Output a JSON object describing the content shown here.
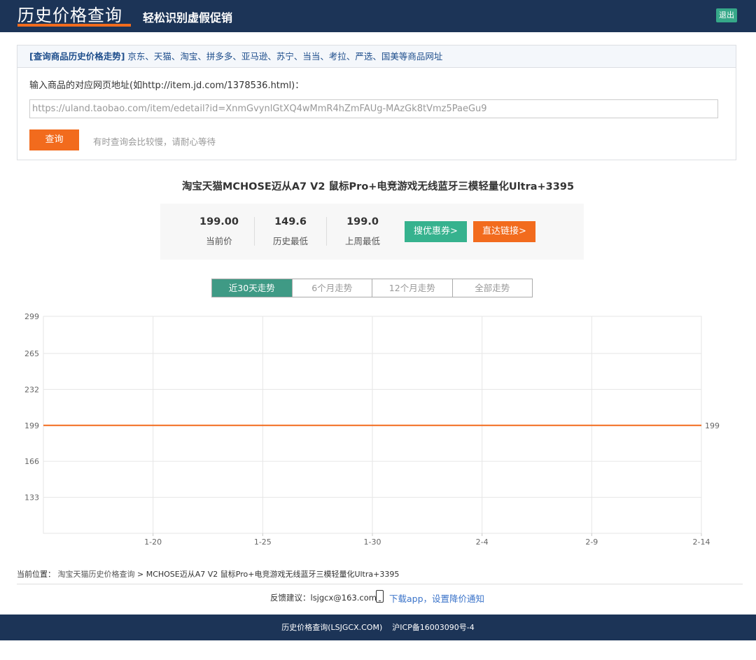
{
  "header": {
    "logo": "历史价格查询",
    "slogan": "轻松识别虚假促销",
    "logout": "退出"
  },
  "query": {
    "head_bold": "[查询商品历史价格走势]",
    "head_sites": "京东、天猫、淘宝、拼多多、亚马逊、苏宁、当当、考拉、严选、国美等商品网址",
    "label": "输入商品的对应网页地址(如http://item.jd.com/1378536.html)：",
    "url_value": "https://uland.taobao.com/item/edetail?id=XnmGvynlGtXQ4wMmR4hZmFAUg-MAzGk8tVmz5PaeGu9",
    "button": "查询",
    "tip": "有时查询会比较慢，请耐心等待"
  },
  "product": {
    "title": "淘宝天猫MCHOSE迈从A7 V2 鼠标Pro+电竞游戏无线蓝牙三模轻量化Ultra+3395",
    "stats": [
      {
        "value": "199.00",
        "label": "当前价"
      },
      {
        "value": "149.6",
        "label": "历史最低"
      },
      {
        "value": "199.0",
        "label": "上周最低"
      }
    ],
    "coupon_button": "搜优惠券>",
    "link_button": "直达链接>"
  },
  "tabs": [
    {
      "label": "近30天走势",
      "active": true
    },
    {
      "label": "6个月走势",
      "active": false
    },
    {
      "label": "12个月走势",
      "active": false
    },
    {
      "label": "全部走势",
      "active": false
    }
  ],
  "chart_data": {
    "type": "line",
    "x": [
      "1-20",
      "1-25",
      "1-30",
      "2-4",
      "2-9",
      "2-14"
    ],
    "y_ticks": [
      299,
      265,
      232,
      199,
      166,
      133
    ],
    "ylim": [
      100,
      299
    ],
    "series": [
      {
        "values": [
          199,
          199,
          199,
          199,
          199,
          199
        ],
        "end_label": "199",
        "color": "#f26b1d"
      }
    ],
    "grid": true
  },
  "footer": {
    "breadcrumb_prefix": "当前位置：",
    "breadcrumb_link": "淘宝天猫历史价格查询",
    "breadcrumb_rest": " > MCHOSE迈从A7 V2 鼠标Pro+电竞游戏无线蓝牙三模轻量化Ultra+3395",
    "feedback": "反馈建议：lsjgcx@163.com",
    "app_link": "下载app，设置降价通知",
    "site": "历史价格查询(LSJGCX.COM)",
    "icp": "沪ICP备16003090号-4"
  }
}
